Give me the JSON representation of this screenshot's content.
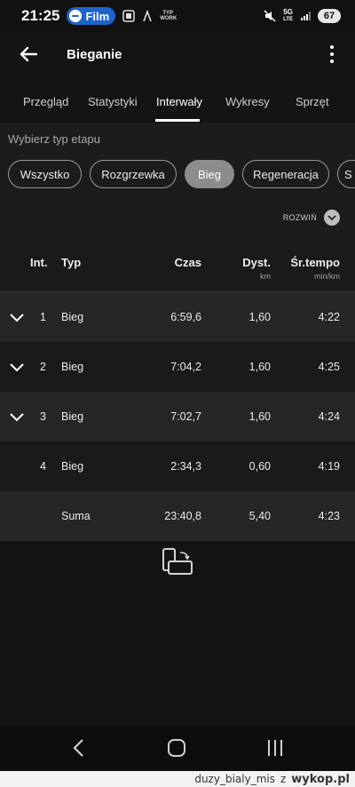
{
  "status_bar": {
    "time": "21:25",
    "media_app": "Film",
    "small_badge": "TYP WORK",
    "network": "5G",
    "network_sub": "LTE",
    "battery": "67"
  },
  "app_bar": {
    "title": "Bieganie",
    "back_icon": "arrow-left-icon",
    "menu_icon": "more-vert-icon"
  },
  "tabs": [
    {
      "label": "Przegląd",
      "active": false
    },
    {
      "label": "Statystyki",
      "active": false
    },
    {
      "label": "Interwały",
      "active": true
    },
    {
      "label": "Wykresy",
      "active": false
    },
    {
      "label": "Sprzęt",
      "active": false
    }
  ],
  "filter": {
    "label": "Wybierz typ etapu",
    "chips": [
      {
        "label": "Wszystko",
        "selected": false
      },
      {
        "label": "Rozgrzewka",
        "selected": false
      },
      {
        "label": "Bieg",
        "selected": true
      },
      {
        "label": "Regeneracja",
        "selected": false
      },
      {
        "label": "S",
        "selected": false
      }
    ],
    "expand_label": "ROZWIŃ"
  },
  "table": {
    "headers": {
      "int": "Int.",
      "type": "Typ",
      "time": "Czas",
      "dist": "Dyst.",
      "dist_unit": "km",
      "pace": "Śr.tempo",
      "pace_unit": "min/km"
    },
    "rows": [
      {
        "int": "1",
        "type": "Bieg",
        "time": "6:59,6",
        "dist": "1,60",
        "pace": "4:22",
        "expandable": true
      },
      {
        "int": "2",
        "type": "Bieg",
        "time": "7:04,2",
        "dist": "1,60",
        "pace": "4:25",
        "expandable": true
      },
      {
        "int": "3",
        "type": "Bieg",
        "time": "7:02,7",
        "dist": "1,60",
        "pace": "4:24",
        "expandable": true
      },
      {
        "int": "4",
        "type": "Bieg",
        "time": "2:34,3",
        "dist": "0,60",
        "pace": "4:19",
        "expandable": false
      }
    ],
    "summary": {
      "label": "Suma",
      "time": "23:40,8",
      "dist": "5,40",
      "pace": "4:23"
    }
  },
  "watermark": {
    "user": "duzy_bialy_mis",
    "suffix": "z",
    "site": "wykop.pl"
  },
  "colors": {
    "background": "#141414",
    "panel": "#1c1c1c",
    "row_light": "#262626",
    "chip_selected": "#8c8c8c",
    "media_pill": "#1e63c9"
  }
}
